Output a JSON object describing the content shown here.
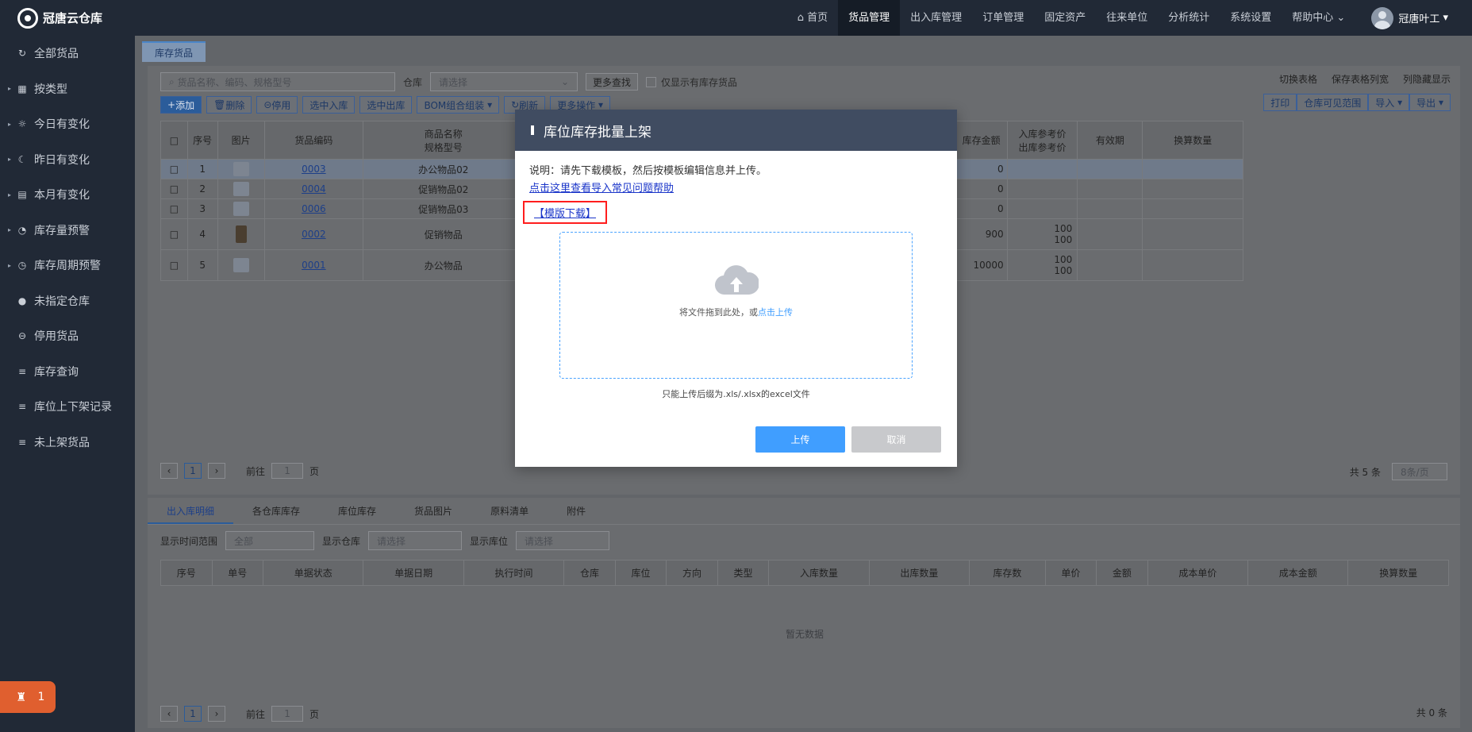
{
  "app": {
    "title": "冠唐云仓库"
  },
  "sidebar": {
    "items": [
      {
        "label": "全部货品",
        "icon": "refresh-icon",
        "arrow": false
      },
      {
        "label": "按类型",
        "icon": "grid-icon",
        "arrow": true
      },
      {
        "label": "今日有变化",
        "icon": "sun-icon",
        "arrow": true
      },
      {
        "label": "昨日有变化",
        "icon": "moon-icon",
        "arrow": true
      },
      {
        "label": "本月有变化",
        "icon": "calendar-icon",
        "arrow": true
      },
      {
        "label": "库存量预警",
        "icon": "warning-icon",
        "arrow": true
      },
      {
        "label": "库存周期预警",
        "icon": "alarm-clock-icon",
        "arrow": true
      },
      {
        "label": "未指定仓库",
        "icon": "question-icon",
        "arrow": false
      },
      {
        "label": "停用货品",
        "icon": "minus-circle-icon",
        "arrow": false
      },
      {
        "label": "库存查询",
        "icon": "list-icon",
        "arrow": false
      },
      {
        "label": "库位上下架记录",
        "icon": "list-icon",
        "arrow": false
      },
      {
        "label": "未上架货品",
        "icon": "list-icon",
        "arrow": false
      }
    ],
    "alarm_count": "1"
  },
  "topnav": {
    "items": [
      "首页",
      "货品管理",
      "出入库管理",
      "订单管理",
      "固定资产",
      "往来单位",
      "分析统计",
      "系统设置",
      "帮助中心"
    ],
    "active": "货品管理",
    "user": "冠唐叶工"
  },
  "page_tab": "库存货品",
  "toolbar": {
    "search_placeholder": "货品名称、编码、规格型号",
    "warehouse_label": "仓库",
    "warehouse_placeholder": "请选择",
    "more_search": "更多查找",
    "only_stock": "仅显示有库存货品",
    "buttons": [
      "添加",
      "删除",
      "停用",
      "选中入库",
      "选中出库",
      "BOM组合组装",
      "刷新",
      "更多操作"
    ],
    "right_tools": [
      "切换表格",
      "保存表格列宽",
      "列隐藏显示"
    ],
    "right_buttons": [
      "打印",
      "仓库可见范围",
      "导入",
      "导出"
    ]
  },
  "goods_table": {
    "headers": [
      "序号",
      "图片",
      "货品编码",
      "商品名称",
      "规格型号",
      "库存金额",
      "入库参考价",
      "出库参考价",
      "有效期",
      "换算数量"
    ],
    "rows": [
      {
        "no": "1",
        "code": "0003",
        "name": "办公物品02",
        "amount": "0",
        "in_price": "",
        "out_price": ""
      },
      {
        "no": "2",
        "code": "0004",
        "name": "促销物品02",
        "amount": "0",
        "in_price": "",
        "out_price": ""
      },
      {
        "no": "3",
        "code": "0006",
        "name": "促销物品03",
        "amount": "0",
        "in_price": "",
        "out_price": ""
      },
      {
        "no": "4",
        "code": "0002",
        "name": "促销物品",
        "amount": "900",
        "in_price": "100",
        "out_price": "100"
      },
      {
        "no": "5",
        "code": "0001",
        "name": "办公物品",
        "amount": "10000",
        "in_price": "100",
        "out_price": "100"
      }
    ]
  },
  "pager": {
    "page": "1",
    "goto_label": "前往",
    "goto_value": "1",
    "page_unit": "页",
    "total": "共 5 条",
    "per_page": "8条/页"
  },
  "bottom": {
    "tabs": [
      "出入库明细",
      "各仓库库存",
      "库位库存",
      "货品图片",
      "原料清单",
      "附件"
    ],
    "filter_time_label": "显示时间范围",
    "filter_time_value": "全部",
    "filter_wh_label": "显示仓库",
    "filter_wh_placeholder": "请选择",
    "filter_loc_label": "显示库位",
    "filter_loc_placeholder": "请选择",
    "headers": [
      "序号",
      "单号",
      "单据状态",
      "单据日期",
      "执行时间",
      "仓库",
      "库位",
      "方向",
      "类型",
      "入库数量",
      "出库数量",
      "库存数",
      "单价",
      "金额",
      "成本单价",
      "成本金额",
      "换算数量"
    ],
    "empty": "暂无数据",
    "total": "共 0 条"
  },
  "modal": {
    "title": "库位库存批量上架",
    "desc": "说明：请先下载模板，然后按模板编辑信息并上传。",
    "help_link": "点击这里查看导入常见问题帮助",
    "download_link": "【模版下载】",
    "drop_text": "将文件拖到此处，或",
    "drop_link": "点击上传",
    "hint": "只能上传后缀为.xls/.xlsx的excel文件",
    "upload_btn": "上传",
    "cancel_btn": "取消"
  }
}
